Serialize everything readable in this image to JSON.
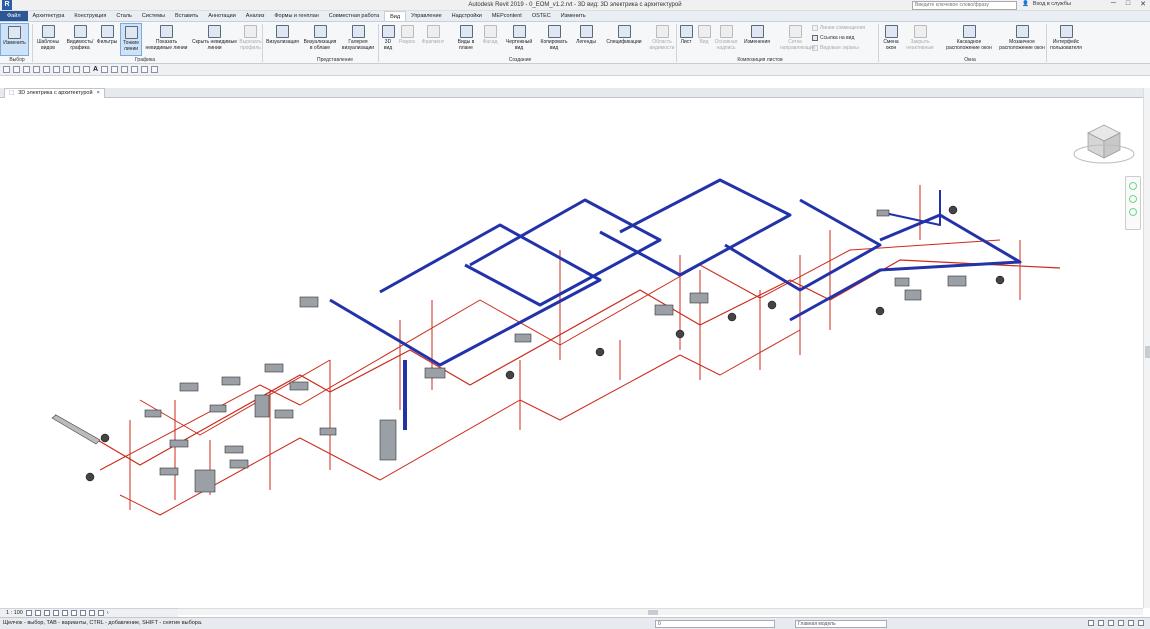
{
  "title": {
    "logo": "R",
    "text": "Autodesk Revit 2019 - 0_EOM_v1.2.rvt - 3D вид: 3D электрика с архитектурой",
    "search_placeholder": "Введите ключевое слово/фразу",
    "signin": "Вход в службы"
  },
  "tabs": [
    "Файл",
    "Архитектура",
    "Конструкция",
    "Сталь",
    "Системы",
    "Вставить",
    "Аннотации",
    "Анализ",
    "Формы и генплан",
    "Совместная работа",
    "Вид",
    "Управление",
    "Надстройки",
    "MEPcontent",
    "OSTEC",
    "Изменить"
  ],
  "active_tab": "Вид",
  "ribbon": {
    "buttons": [
      {
        "label": "Изменить",
        "state": "selected"
      },
      {
        "label": "Шаблоны видов",
        "state": "normal"
      },
      {
        "label": "Видимость/ графика",
        "state": "normal"
      },
      {
        "label": "Фильтры",
        "state": "normal"
      },
      {
        "label": "Тонкие линии",
        "state": "selected"
      },
      {
        "label": "Показать невидимые линии",
        "state": "normal"
      },
      {
        "label": "Скрыть невидимые линии",
        "state": "normal"
      },
      {
        "label": "Вырезать профиль",
        "state": "dim"
      },
      {
        "label": "Визуализация",
        "state": "normal"
      },
      {
        "label": "Визуализация в облаке",
        "state": "normal"
      },
      {
        "label": "Галерея визуализации",
        "state": "normal"
      },
      {
        "label": "3D вид",
        "state": "normal"
      },
      {
        "label": "Разрез",
        "state": "dim"
      },
      {
        "label": "Фрагмент",
        "state": "dim"
      },
      {
        "label": "Виды в плане",
        "state": "normal"
      },
      {
        "label": "Фасад",
        "state": "dim"
      },
      {
        "label": "Чертежный вид",
        "state": "normal"
      },
      {
        "label": "Копировать вид",
        "state": "normal"
      },
      {
        "label": "Легенды",
        "state": "normal"
      },
      {
        "label": "Спецификации",
        "state": "normal"
      },
      {
        "label": "Область видимости",
        "state": "dim"
      },
      {
        "label": "Лист",
        "state": "normal"
      },
      {
        "label": "Вид",
        "state": "dim"
      },
      {
        "label": "Основная надпись",
        "state": "dim"
      },
      {
        "label": "Изменения",
        "state": "normal"
      },
      {
        "label": "Сетка направляющих",
        "state": "dim"
      },
      {
        "label": "Смена окон",
        "state": "normal"
      },
      {
        "label": "Закрыть неактивные",
        "state": "dim"
      },
      {
        "label": "Каскадное расположение окон",
        "state": "normal"
      },
      {
        "label": "Мозаичное расположение окон",
        "state": "normal"
      },
      {
        "label": "Интерфейс пользователя",
        "state": "normal"
      }
    ],
    "small_items": [
      {
        "label": "Линии совмещения",
        "state": "dim"
      },
      {
        "label": "Ссылка на вид",
        "state": "normal"
      },
      {
        "label": "Видовые экраны",
        "state": "dim"
      }
    ],
    "panels": [
      "Выбор",
      "Графика",
      "Представление",
      "Создание",
      "Композиция листов",
      "Окна"
    ]
  },
  "document_tab": {
    "label": "3D электрика с архитектурой",
    "close": "×"
  },
  "view_control": {
    "scale": "1 : 100"
  },
  "status": {
    "message": "Щелчок - выбор, TAB - варианты, CTRL - добавление, SHIFT - снятие выбора.",
    "workset": "0",
    "model": "Главная модель"
  },
  "colors": {
    "wire": "#cc2a1a",
    "tray": "#2233aa",
    "accent": "#2b5797"
  }
}
